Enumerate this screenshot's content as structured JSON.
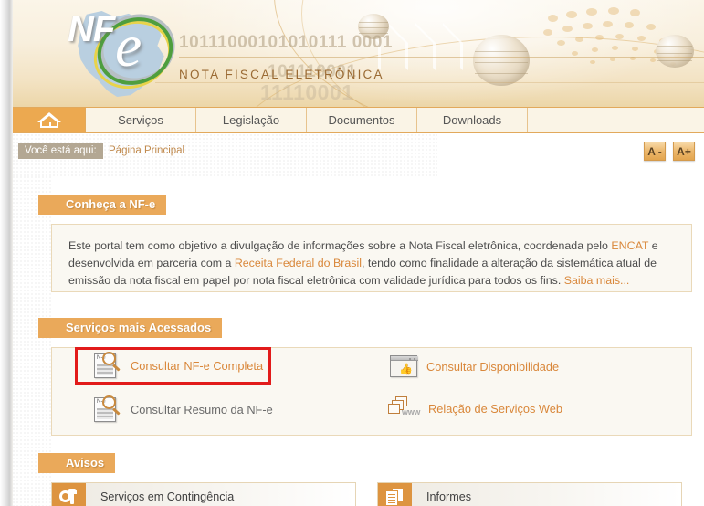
{
  "header": {
    "logo_nf": "NF",
    "logo_e": "e",
    "subtitle": "NOTA FISCAL ELETRÔNICA",
    "binary_1": "10111000101010111 0001",
    "binary_2": "101110001",
    "binary_3": "11110001"
  },
  "nav": {
    "home_icon": "home-icon",
    "items": [
      {
        "label": "Serviços"
      },
      {
        "label": "Legislação"
      },
      {
        "label": "Documentos"
      },
      {
        "label": "Downloads"
      }
    ]
  },
  "breadcrumb": {
    "label": "Você está aqui:",
    "current": "Página Principal"
  },
  "font_size": {
    "decrease": "A -",
    "increase": "A+"
  },
  "sections": {
    "conheca": {
      "title": "Conheça a NF-e",
      "text_1": "Este portal tem como objetivo a divulgação de informações sobre a Nota Fiscal eletrônica, coordenada pelo ",
      "link_encat": "ENCAT",
      "text_2": " e desenvolvida em parceria com a ",
      "link_receita": "Receita Federal do Brasil",
      "text_3": ", tendo como finalidade a alteração da sistemática atual de emissão da nota fiscal em papel por nota fiscal eletrônica com validade jurídica para todos os fins. ",
      "link_saiba": "Saiba mais..."
    },
    "servicos": {
      "title": "Serviços mais Acessados",
      "items": [
        {
          "label": "Consultar NF-e Completa",
          "icon": "document-search-icon",
          "highlighted": true
        },
        {
          "label": "Consultar Disponibilidade",
          "icon": "window-thumbsup-icon",
          "highlighted": false
        },
        {
          "label": "Consultar Resumo da NF-e",
          "icon": "document-search-icon",
          "highlighted": false
        },
        {
          "label": "Relação de Serviços Web",
          "icon": "www-windows-icon",
          "highlighted": false
        }
      ]
    },
    "avisos": {
      "title": "Avisos",
      "panels": [
        {
          "title": "Serviços em Contingência",
          "icon": "gear-wrench-icon"
        },
        {
          "title": "Informes",
          "icon": "documents-icon"
        }
      ]
    }
  },
  "colors": {
    "accent_orange": "#eaa95a",
    "link_orange": "#d9873a",
    "highlight_red": "#e21b1b",
    "panel_bg": "#faf8f2"
  }
}
